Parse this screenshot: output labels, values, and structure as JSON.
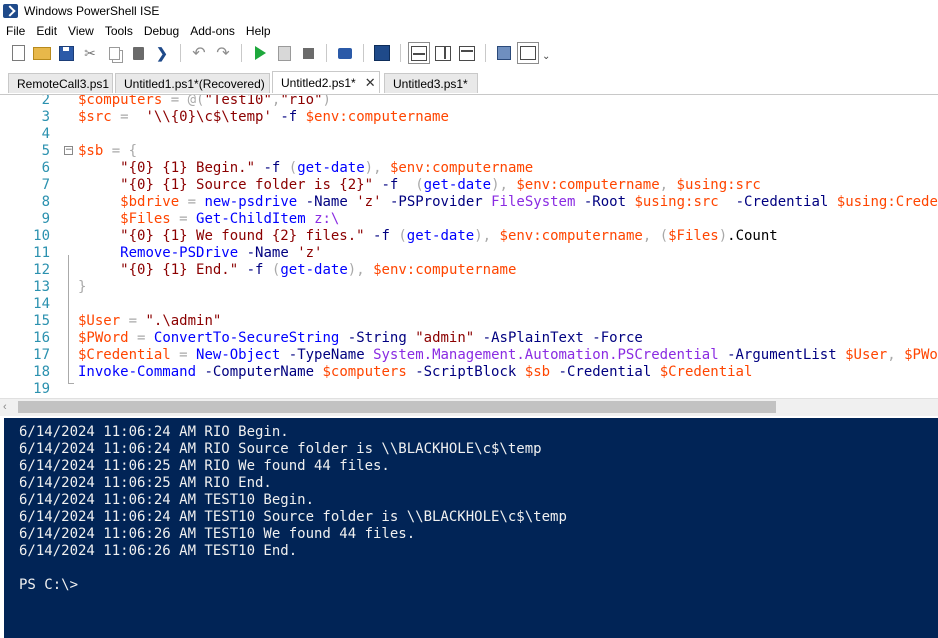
{
  "window": {
    "title": "Windows PowerShell ISE"
  },
  "menu": [
    "File",
    "Edit",
    "View",
    "Tools",
    "Debug",
    "Add-ons",
    "Help"
  ],
  "toolbar": {
    "icons": [
      "new-icon",
      "open-icon",
      "save-icon",
      "cut-icon",
      "copy-icon",
      "paste-icon",
      "powershell-icon",
      "undo-icon",
      "redo-icon",
      "run-script-icon",
      "run-selection-icon",
      "stop-icon",
      "remote-powershell-icon",
      "powershell-console-icon",
      "script-pane-top-icon",
      "script-pane-right-icon",
      "script-pane-maximized-icon",
      "command-window-icon",
      "addons-pane-icon",
      "overflow-icon"
    ],
    "overflow": "⌄"
  },
  "tabs": [
    {
      "label": "RemoteCall3.ps1"
    },
    {
      "label": "Untitled1.ps1*(Recovered)"
    },
    {
      "label": "Untitled2.ps1*",
      "active": true,
      "close": "✕"
    },
    {
      "label": "Untitled3.ps1*"
    }
  ],
  "editor": {
    "lines": [
      {
        "n": "2",
        "code": "$computers = @(\"Test10\",\"rio\")"
      },
      {
        "n": "3",
        "code": "$src =  '\\\\{0}\\c$\\temp' -f $env:computername"
      },
      {
        "n": "4",
        "code": ""
      },
      {
        "n": "5",
        "code": "$sb = {"
      },
      {
        "n": "6",
        "code": "     \"{0} {1} Begin.\" -f (get-date), $env:computername"
      },
      {
        "n": "7",
        "code": "     \"{0} {1} Source folder is {2}\" -f  (get-date), $env:computername, $using:src"
      },
      {
        "n": "8",
        "code": "     $bdrive = new-psdrive -Name 'z' -PSProvider FileSystem -Root $using:src  -Credential $using:Credential"
      },
      {
        "n": "9",
        "code": "     $Files = Get-ChildItem z:\\"
      },
      {
        "n": "10",
        "code": "     \"{0} {1} We found {2} files.\" -f (get-date), $env:computername, ($Files).Count"
      },
      {
        "n": "11",
        "code": "     Remove-PSDrive -Name 'z'"
      },
      {
        "n": "12",
        "code": "     \"{0} {1} End.\" -f (get-date), $env:computername"
      },
      {
        "n": "13",
        "code": "}"
      },
      {
        "n": "14",
        "code": ""
      },
      {
        "n": "15",
        "code": "$User = \".\\admin\""
      },
      {
        "n": "16",
        "code": "$PWord = ConvertTo-SecureString -String \"admin\" -AsPlainText -Force"
      },
      {
        "n": "17",
        "code": "$Credential = New-Object -TypeName System.Management.Automation.PSCredential -ArgumentList $User, $PWord"
      },
      {
        "n": "18",
        "code": "Invoke-Command -ComputerName $computers -ScriptBlock $sb -Credential $Credential"
      },
      {
        "n": "19",
        "code": ""
      }
    ]
  },
  "console": {
    "lines": [
      "6/14/2024 11:06:24 AM RIO Begin.",
      "6/14/2024 11:06:24 AM RIO Source folder is \\\\BLACKHOLE\\c$\\temp",
      "6/14/2024 11:06:25 AM RIO We found 44 files.",
      "6/14/2024 11:06:25 AM RIO End.",
      "6/14/2024 11:06:24 AM TEST10 Begin.",
      "6/14/2024 11:06:24 AM TEST10 Source folder is \\\\BLACKHOLE\\c$\\temp",
      "6/14/2024 11:06:26 AM TEST10 We found 44 files.",
      "6/14/2024 11:06:26 AM TEST10 End.",
      "",
      "PS C:\\>"
    ]
  },
  "colors": {
    "console_bg": "#012456",
    "line_number": "#2b91af",
    "variable": "#ff4500",
    "string": "#8b0000",
    "command": "#0000ff",
    "parameter": "#000080",
    "type": "#8a2be2",
    "operator": "#a9a9a9"
  }
}
